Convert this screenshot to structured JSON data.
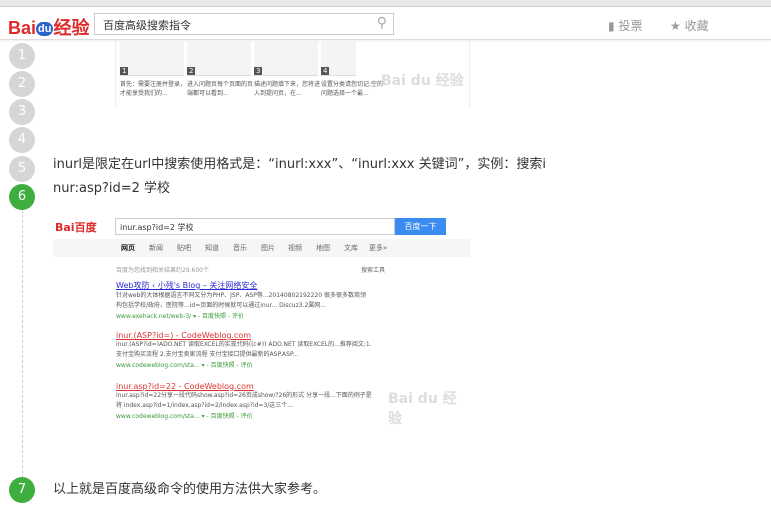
{
  "header": {
    "logo_main": "Bai",
    "logo_du": "du",
    "logo_suffix": "经验",
    "search_value": "百度高级搜索指令",
    "vote_label": "投票",
    "fav_label": "收藏"
  },
  "steps": [
    "1",
    "2",
    "3",
    "4",
    "5",
    "6",
    "7"
  ],
  "thumbs": [
    {
      "n": "1",
      "caption": "首先：需要注册并登录，才能享受我们的..."
    },
    {
      "n": "2",
      "caption": "进入问题页每个页面的页端都可以看到..."
    },
    {
      "n": "3",
      "caption": "描述问题填下来，您将进入到提问页，在..."
    },
    {
      "n": "4",
      "caption": "设置分类请您切记:空的问题选择一个最..."
    }
  ],
  "step6": {
    "line1": "inurl是限定在url中搜索使用格式是：“inurl:xxx”、“inurl:xxx 关键词”，实例：搜索i",
    "line2": "nur:asp?id=2 学校"
  },
  "shot": {
    "logo": "Bai百度",
    "query": "inur.asp?id=2 学校",
    "button": "百度一下",
    "nav": [
      "网页",
      "新闻",
      "贴吧",
      "知道",
      "音乐",
      "图片",
      "视频",
      "地图",
      "文库",
      "更多»"
    ],
    "count": "百度为您找到相关结果约29,600个",
    "tools": "搜索工具",
    "results": [
      {
        "title": "Web攻防 ‹ 小残's Blog – 关注网络安全",
        "d1": "针对web的大体根据语言不同又分为PHP、JSP、ASP等...20140802192220 很多很多数商领",
        "d2": "构包括学校/政府、医院等...id=页面的时候就可以通过inur... Discuz3.2属网...",
        "url": "www.exehack.net/web-3/  ▾ - 百度快照 - 评价"
      },
      {
        "title": "inur.(ASP?id=) - CodeWeblog.com",
        "d1": "inur.(ASP?id=)ADO.NET 读取EXCEL的实现代码((c#)) ADO.NET 读取EXCEL的...推荐阅文:1.",
        "d2": "支付宝购买流程 2.支付宝卖家流程 支付宝接口提供最新的ASP.ASP...",
        "url": "www.codeweblog.com/sta...  ▾ - 百度快照 - 评价"
      },
      {
        "title": "inur.asp?id=22 - CodeWeblog.com",
        "d1": "inur.asp?id=22分享一段代码show.asp?id=26页成show/?26的形式 分享一段...下面的例子是",
        "d2": "将 index.asp?id=1/index.asp?id=2/index.asp?id=3/这三个...",
        "url": "www.codeweblog.com/sta...  ▾ - 百度快照 - 评价"
      }
    ]
  },
  "step7": {
    "text": "以上就是百度高级命令的使用方法供大家参考。"
  },
  "watermark": "Bai du 经验"
}
